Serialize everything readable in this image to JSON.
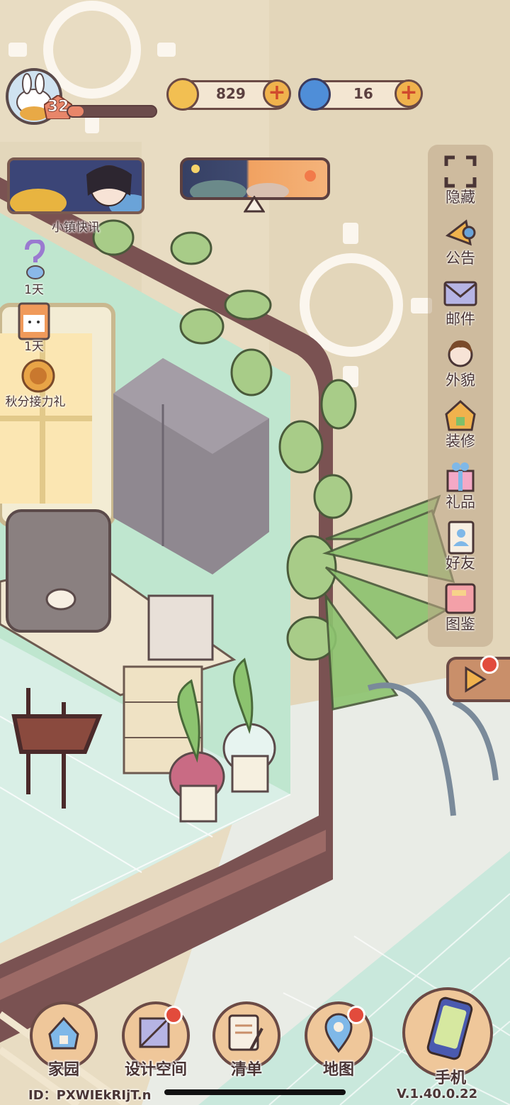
{
  "player": {
    "level": "32",
    "xp_progress": 0.18
  },
  "currencies": {
    "coins": "829",
    "gems": "16"
  },
  "news_banner": {
    "label": "小镇快讯"
  },
  "events": [
    {
      "icon": "question-potion-icon",
      "label": "1天"
    },
    {
      "icon": "milk-box-icon",
      "label": "1天"
    },
    {
      "icon": "mooncake-icon",
      "label": "秋分接力礼"
    }
  ],
  "side_menu": [
    {
      "icon": "hide-frame-icon",
      "label": "隐藏"
    },
    {
      "icon": "megaphone-icon",
      "label": "公告"
    },
    {
      "icon": "mail-icon",
      "label": "邮件"
    },
    {
      "icon": "avatar-face-icon",
      "label": "外貌"
    },
    {
      "icon": "house-wrench-icon",
      "label": "装修"
    },
    {
      "icon": "gift-box-icon",
      "label": "礼品"
    },
    {
      "icon": "contact-book-icon",
      "label": "好友"
    },
    {
      "icon": "album-icon",
      "label": "图鉴"
    }
  ],
  "bottom_nav": [
    {
      "icon": "home-icon",
      "label": "家园",
      "badge": false
    },
    {
      "icon": "design-space-icon",
      "label": "设计空间",
      "badge": true
    },
    {
      "icon": "checklist-icon",
      "label": "清单",
      "badge": false
    },
    {
      "icon": "map-pin-icon",
      "label": "地图",
      "badge": true
    },
    {
      "icon": "phone-icon",
      "label": "手机",
      "badge": false
    }
  ],
  "footer": {
    "id_text": "ID：PXWIEkRIjT.n",
    "version": "V.1.40.0.22"
  },
  "colors": {
    "wall": "#e8dcc2",
    "room_wall": "#bfe6cf",
    "frame": "#7a5252",
    "accent_orange": "#f0b24d",
    "badge_red": "#e24b3c"
  }
}
